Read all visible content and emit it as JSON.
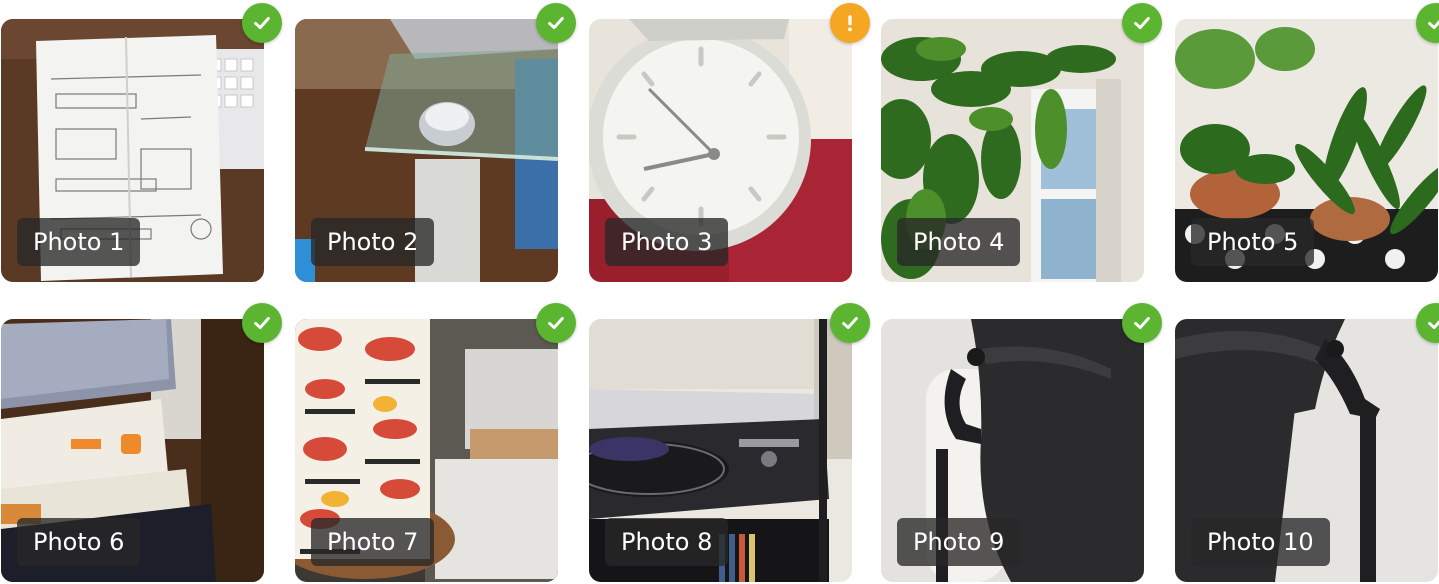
{
  "colors": {
    "ok": "#5cb531",
    "warning": "#f5a623"
  },
  "photos": [
    {
      "label": "Photo 1",
      "status": "ok",
      "status_icon": "check-icon"
    },
    {
      "label": "Photo 2",
      "status": "ok",
      "status_icon": "check-icon"
    },
    {
      "label": "Photo 3",
      "status": "warning",
      "status_icon": "exclamation-icon"
    },
    {
      "label": "Photo 4",
      "status": "ok",
      "status_icon": "check-icon"
    },
    {
      "label": "Photo 5",
      "status": "ok",
      "status_icon": "check-icon"
    },
    {
      "label": "Photo 6",
      "status": "ok",
      "status_icon": "check-icon"
    },
    {
      "label": "Photo 7",
      "status": "ok",
      "status_icon": "check-icon"
    },
    {
      "label": "Photo 8",
      "status": "ok",
      "status_icon": "check-icon"
    },
    {
      "label": "Photo 9",
      "status": "ok",
      "status_icon": "check-icon"
    },
    {
      "label": "Photo 10",
      "status": "ok",
      "status_icon": "check-icon"
    }
  ]
}
